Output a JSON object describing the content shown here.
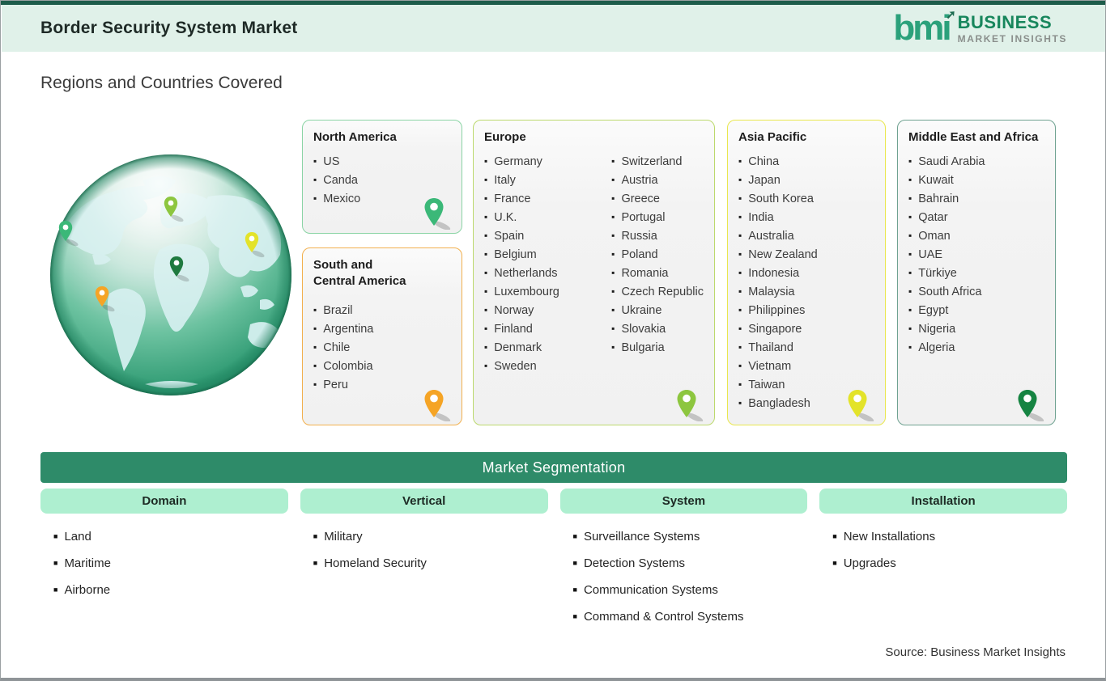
{
  "header": {
    "title": "Border Security System Market",
    "logo": {
      "mark": "bmi",
      "line1": "BUSINESS",
      "line2": "MARKET INSIGHTS"
    }
  },
  "icons": {
    "logo_arrow": "➚"
  },
  "section_title": "Regions and Countries Covered",
  "palette": {
    "top_line": "#1d5c4a",
    "header_bg": "#e0f1e9",
    "bar_green": "#2e8b69",
    "pill_green": "#aeefd0",
    "logo_green": "#2ba17b",
    "business_green": "#17865c",
    "insights_gray": "#8a8f8c"
  },
  "regions": [
    {
      "name": "North America",
      "border_color": "#8bd4a5",
      "pin_color": "#3bb878",
      "columns": [
        [
          "US",
          "Canda",
          "Mexico"
        ]
      ]
    },
    {
      "name": "South and Central America",
      "border_color": "#f2b04e",
      "pin_color": "#f5a425",
      "columns": [
        [
          "Brazil",
          "Argentina",
          "Chile",
          "Colombia",
          "Peru"
        ]
      ]
    },
    {
      "name": "Europe",
      "border_color": "#bcd96d",
      "pin_color": "#8dc63f",
      "columns": [
        [
          "Germany",
          "Italy",
          "France",
          "U.K.",
          "Spain",
          "Belgium",
          "Netherlands",
          "Luxembourg",
          "Norway",
          "Finland",
          "Denmark",
          "Sweden"
        ],
        [
          "Switzerland",
          "Austria",
          "Greece",
          "Portugal",
          "Russia",
          "Poland",
          "Romania",
          "Czech Republic",
          "Ukraine",
          "Slovakia",
          "Bulgaria"
        ]
      ]
    },
    {
      "name": "Asia Pacific",
      "border_color": "#e9e74e",
      "pin_color": "#e3e32a",
      "columns": [
        [
          "China",
          "Japan",
          "South Korea",
          "India",
          "Australia",
          "New Zealand",
          "Indonesia",
          "Malaysia",
          "Philippines",
          "Singapore",
          "Thailand",
          "Vietnam",
          "Taiwan",
          "Bangladesh"
        ]
      ]
    },
    {
      "name": "Middle East and Africa",
      "border_color": "#6fa291",
      "pin_color": "#168442",
      "columns": [
        [
          "Saudi Arabia",
          "Kuwait",
          "Bahrain",
          "Qatar",
          "Oman",
          "UAE",
          "Türkiye",
          "South Africa",
          "Egypt",
          "Nigeria",
          "Algeria"
        ]
      ]
    }
  ],
  "segmentation": {
    "title": "Market Segmentation",
    "groups": [
      {
        "name": "Domain",
        "items": [
          "Land",
          "Maritime",
          "Airborne"
        ]
      },
      {
        "name": "Vertical",
        "items": [
          "Military",
          "Homeland Security"
        ]
      },
      {
        "name": "System",
        "items": [
          "Surveillance Systems",
          "Detection Systems",
          "Communication Systems",
          "Command & Control Systems"
        ]
      },
      {
        "name": "Installation",
        "items": [
          "New Installations",
          "Upgrades"
        ]
      }
    ]
  },
  "footer": {
    "source": "Source: Business Market Insights"
  }
}
